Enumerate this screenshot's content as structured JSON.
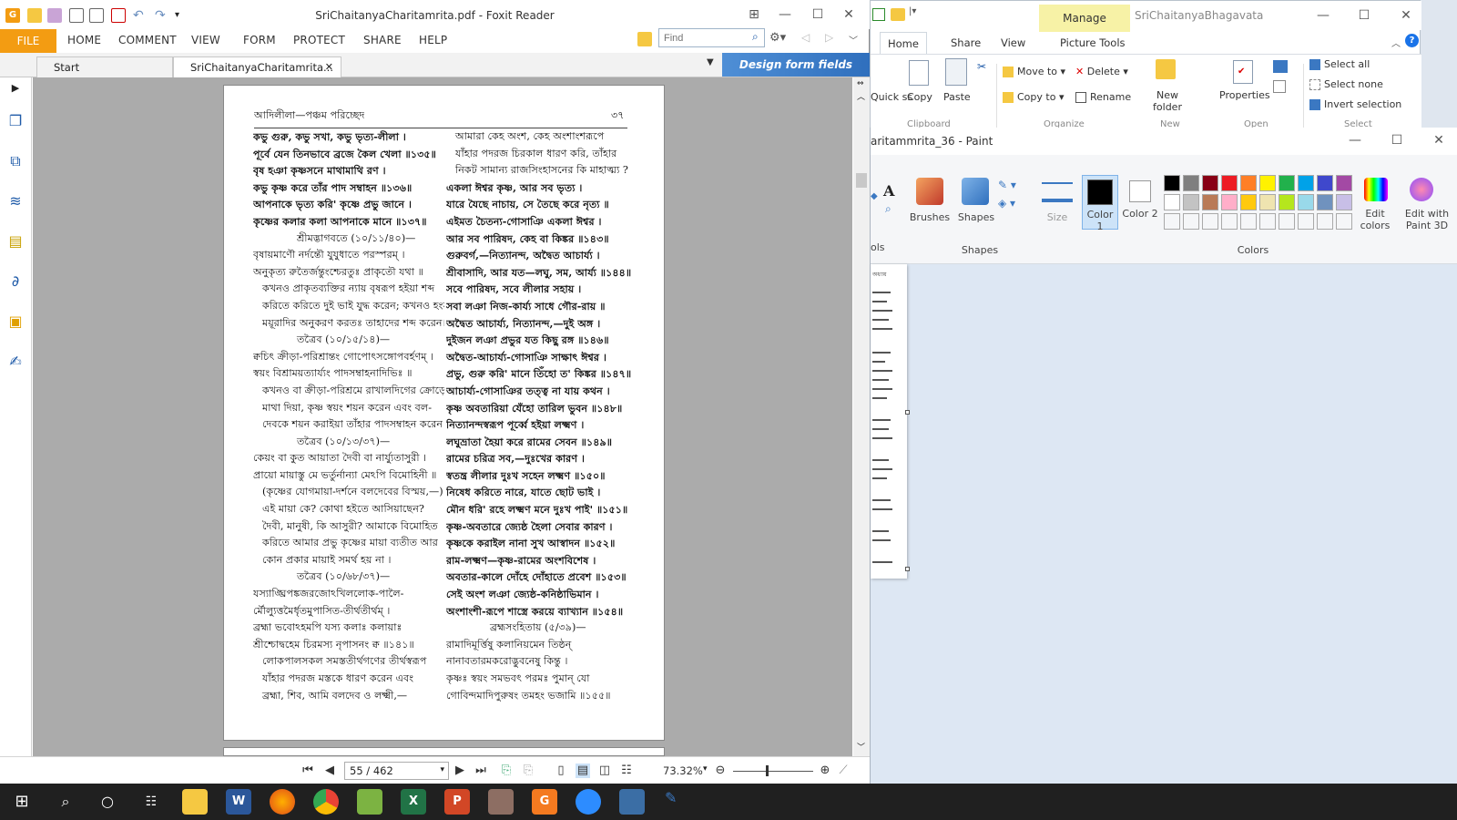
{
  "explorer": {
    "manage_tab": "Manage",
    "title": "SriChaitanyaBhagavata",
    "tabs": [
      "Home",
      "Share",
      "View",
      "Picture Tools"
    ],
    "ribbon": {
      "quick": "Quick\nss",
      "copy": "Copy",
      "paste": "Paste",
      "move_to": "Move to",
      "copy_to": "Copy to",
      "delete": "Delete",
      "rename": "Rename",
      "new_folder": "New folder",
      "properties": "Properties",
      "select_all": "Select all",
      "select_none": "Select none",
      "invert_selection": "Invert selection",
      "groups": [
        "Clipboard",
        "Organize",
        "New",
        "Open",
        "Select"
      ]
    }
  },
  "paint": {
    "title": "aritammrita_36 - Paint",
    "tools_label": "ols",
    "brushes": "Brushes",
    "shapes": "Shapes",
    "size": "Size",
    "color1": "Color 1",
    "color2": "Color 2",
    "edit_colors": "Edit colors",
    "edit_paint3d": "Edit with Paint 3D",
    "group_shapes": "Shapes",
    "group_colors": "Colors",
    "palette": [
      "#000000",
      "#7f7f7f",
      "#880015",
      "#ed1c24",
      "#ff7f27",
      "#fff200",
      "#22b14c",
      "#00a2e8",
      "#3f48cc",
      "#a349a4",
      "#ffffff",
      "#c3c3c3",
      "#b97a57",
      "#ffaec9",
      "#ffc90e",
      "#efe4b0",
      "#b5e61d",
      "#99d9ea",
      "#7092be",
      "#c8bfe7"
    ],
    "canvas_header": "অধ্যায়"
  },
  "foxit": {
    "title": "SriChaitanyaCharitamrita.pdf - Foxit Reader",
    "menu": {
      "file": "FILE",
      "items": [
        "HOME",
        "COMMENT",
        "VIEW",
        "FORM",
        "PROTECT",
        "SHARE",
        "HELP"
      ]
    },
    "find_placeholder": "Find",
    "tabs": {
      "start": "Start",
      "doc": "SriChaitanyaCharitamrita..."
    },
    "banner": "Design form fields easily",
    "status": {
      "page": "55 / 462",
      "zoom": "73.32%"
    }
  },
  "document": {
    "header_left": "আদিলীলা—পঞ্চম পরিচ্ছেদ",
    "header_right": "৩৭",
    "left_col": [
      {
        "t": "কভু গুরু, কভু সখা, কভু ভৃত্য-লীলা ।",
        "s": "b"
      },
      {
        "t": "পূর্বে যেন তিনভাবে ব্রজে কৈল খেলা ॥১৩৫॥",
        "s": "b"
      },
      {
        "t": "বৃষ হঞা কৃষ্ণসনে মাথামাথি রণ ।",
        "s": "b"
      },
      {
        "t": "কভু কৃষ্ণ করে তাঁর পাদ সম্বাহন ॥১৩৬॥",
        "s": "b"
      },
      {
        "t": "আপনাকে ভৃত্য করি' কৃষ্ণে প্রভু জানে ।",
        "s": "b"
      },
      {
        "t": "কৃষ্ণের কলার কলা আপনাকে মানে ॥১৩৭॥",
        "s": "b"
      },
      {
        "t": "শ্রীমদ্ভাগবতে (১০/১১/৪০)—",
        "s": "c"
      },
      {
        "t": "বৃষায়মাণৌ নর্দন্তৌ যুযুধাতে পরস্পরম্ ।",
        "s": ""
      },
      {
        "t": "অনুকৃত্য রুতৈর্জন্তুংশ্চেরতুঃ প্রাকৃতৌ যথা ॥",
        "s": ""
      },
      {
        "t": "কখনও প্রাকৃতব্যক্তির ন্যায় বৃষরূপ হইয়া শব্দ",
        "s": "i"
      },
      {
        "t": "করিতে করিতে দুই ভাই যুদ্ধ করেন; কখনও হংস-",
        "s": "i"
      },
      {
        "t": "ময়ূরাদির অনুকরণ করতঃ তাহাদের শব্দ করেন।",
        "s": "i"
      },
      {
        "t": "তত্রৈব (১০/১৫/১৪)—",
        "s": "c"
      },
      {
        "t": "ক্বচিৎ ক্রীড়া-পরিশ্রান্তং গোপোৎসঙ্গোপবর্হণম্ ।",
        "s": ""
      },
      {
        "t": "স্বয়ং বিশ্রাময়ত্যার্য্যং পাদসম্বাহনাদিভিঃ ॥",
        "s": ""
      },
      {
        "t": "কখনও বা ক্রীড়া-পরিশ্রমে রাখালদিগের ক্রোড়ে",
        "s": "i"
      },
      {
        "t": "মাথা দিয়া, কৃষ্ণ স্বয়ং শয়ন করেন এবং বল-",
        "s": "i"
      },
      {
        "t": "দেবকে শয়ন করাইয়া তাঁহার পাদসম্বাহন করেন।",
        "s": "i"
      },
      {
        "t": "তত্রৈব (১০/১৩/৩৭)—",
        "s": "c"
      },
      {
        "t": "কেয়ং বা কুত আয়াতা দৈবী বা নার্য্যুতাসুরী ।",
        "s": ""
      },
      {
        "t": "প্রায়ো মায়াস্তু মে ভর্তুর্নান্যা মেঽপি বিমোহিনী ॥",
        "s": ""
      },
      {
        "t": "(কৃষ্ণের যোগমায়া-দর্শনে বলদেবের বিস্ময়,—)",
        "s": "i"
      },
      {
        "t": "এই মায়া কে? কোথা হইতে আসিয়াছেন?",
        "s": "i"
      },
      {
        "t": "দৈবী, মানুষী, কি আসুরী? আমাকে বিমোহিত",
        "s": "i"
      },
      {
        "t": "করিতে আমার প্রভু কৃষ্ণের মায়া ব্যতীত আর",
        "s": "i"
      },
      {
        "t": "কোন প্রকার মায়াই সমর্থ হয় না ।",
        "s": "i"
      },
      {
        "t": "তত্রৈব (১০/৬৮/৩৭)—",
        "s": "c"
      },
      {
        "t": "যস্যাঙ্ঘ্রিপঙ্কজরজোঽখিললোক-পালৈ-",
        "s": ""
      },
      {
        "t": "র্মৌল্যুত্তমৈর্ধৃতমুপাসিত-তীর্থতীর্থম্ ।",
        "s": ""
      },
      {
        "t": "ব্রহ্মা ভবোঽহমপি যস্য কলাঃ কলায়াঃ",
        "s": ""
      },
      {
        "t": "শ্রীশ্চোদ্বহেম চিরমস্য নৃপাসনং ক্ব ॥১৪১॥",
        "s": ""
      },
      {
        "t": "লোকপালসকল সমস্ততীর্থগণের তীর্থস্বরূপ",
        "s": "i"
      },
      {
        "t": "যাঁহার পদরজ মস্তকে ধারণ করেন এবং",
        "s": "i"
      },
      {
        "t": "ব্রহ্মা, শিব, আমি বলদেব ও লক্ষ্মী,—",
        "s": "i"
      }
    ],
    "right_col": [
      {
        "t": "আমারা কেহ অংশ, কেহ অংশাংশরূপে",
        "s": "i"
      },
      {
        "t": "যাঁহার পদরজ চিরকাল ধারণ করি, তাঁহার",
        "s": "i"
      },
      {
        "t": "নিকট সামান্য রাজসিংহাসনের কি মাহাত্ম্য ?",
        "s": "i"
      },
      {
        "t": "একলা ঈশ্বর কৃষ্ণ, আর সব ভৃত্য ।",
        "s": "b"
      },
      {
        "t": "যারে যৈছে নাচায়, সে তৈছে করে নৃত্য ॥",
        "s": "b"
      },
      {
        "t": "এইমত চৈতন্য-গোসাঞি একলা ঈশ্বর ।",
        "s": "b"
      },
      {
        "t": "আর সব পারিষদ, কেহ বা কিঙ্কর ॥১৪৩॥",
        "s": "b"
      },
      {
        "t": "গুরুবর্গ,—নিত্যানন্দ, অদ্বৈত আচার্য্য ।",
        "s": "b"
      },
      {
        "t": "শ্রীবাসাদি, আর যত—লঘু, সম, আর্য্য ॥১৪৪॥",
        "s": "b"
      },
      {
        "t": "সবে পারিষদ, সবে লীলার সহায় ।",
        "s": "b"
      },
      {
        "t": "সবা লঞা নিজ-কার্য্য সাধে গৌর-রায় ॥",
        "s": "b"
      },
      {
        "t": "অদ্বৈত আচার্য্য, নিত্যানন্দ,—দুই অঙ্গ ।",
        "s": "b"
      },
      {
        "t": "দুইজন লঞা প্রভুর যত কিছু রঙ্গ ॥১৪৬॥",
        "s": "b"
      },
      {
        "t": "অদ্বৈত-আচার্য্য-গোসাঞি সাক্ষাৎ ঈশ্বর ।",
        "s": "b"
      },
      {
        "t": "প্রভু, গুরু করি' মানে তিঁহো ত' কিঙ্কর ॥১৪৭॥",
        "s": "b"
      },
      {
        "t": "আচার্য্য-গোসাঞির তত্ত্ব না যায় কথন ।",
        "s": "b"
      },
      {
        "t": "কৃষ্ণ অবতারিয়া যেঁহো তারিল ভুবন ॥১৪৮॥",
        "s": "b"
      },
      {
        "t": "নিত্যানন্দস্বরূপ পূর্ব্বে হইয়া লক্ষ্মণ ।",
        "s": "b"
      },
      {
        "t": "লঘুভ্রাতা হৈয়া করে রামের সেবন ॥১৪৯॥",
        "s": "b"
      },
      {
        "t": "রামের চরিত্র সব,—দুঃখের কারণ ।",
        "s": "b"
      },
      {
        "t": "স্বতন্ত্র লীলার দুঃখ সহেন লক্ষ্মণ ॥১৫০॥",
        "s": "b"
      },
      {
        "t": "নিষেধ করিতে নারে, যাতে ছোট ভাই ।",
        "s": "b"
      },
      {
        "t": "মৌন ধরি' রহে লক্ষ্মণ মনে দুঃখ পাই' ॥১৫১॥",
        "s": "b"
      },
      {
        "t": "কৃষ্ণ-অবতারে জ্যেষ্ঠ হৈলা সেবার কারণ ।",
        "s": "b"
      },
      {
        "t": "কৃষ্ণকে করাইল নানা সুখ আস্বাদন ॥১৫২॥",
        "s": "b"
      },
      {
        "t": "রাম-লক্ষ্মণ—কৃষ্ণ-রামের অংশবিশেষ ।",
        "s": "b"
      },
      {
        "t": "অবতার-কালে দোঁহে দোঁহাতে প্রবেশ ॥১৫৩॥",
        "s": "b"
      },
      {
        "t": "সেই অংশ লঞা জ্যেষ্ঠ-কনিষ্ঠাভিমান ।",
        "s": "b"
      },
      {
        "t": "অংশাংশী-রূপে শাস্ত্রে করয়ে ব্যাখ্যান ॥১৫৪॥",
        "s": "b"
      },
      {
        "t": "ব্রহ্মসংহিতায় (৫/৩৯)—",
        "s": "c"
      },
      {
        "t": "রামাদিমূর্ত্তিষু কলানিয়মেন তিষ্ঠন্",
        "s": ""
      },
      {
        "t": "নানাবতারমকরোদ্ভুবনেষু কিন্তু ।",
        "s": ""
      },
      {
        "t": "কৃষ্ণঃ স্বয়ং সমভবৎ পরমঃ পুমান্ যো",
        "s": ""
      },
      {
        "t": "গোবিন্দমাদিপুরুষং তমহং ভজামি ॥১৫৫॥",
        "s": ""
      }
    ]
  },
  "taskbar": {
    "apps": [
      "Start",
      "Search",
      "Cortana",
      "Task View",
      "File Explorer",
      "Word",
      "Firefox",
      "Chrome",
      "Notepad",
      "Excel",
      "PowerPoint",
      "App",
      "Foxit",
      "Zoom",
      "Calculator"
    ]
  }
}
